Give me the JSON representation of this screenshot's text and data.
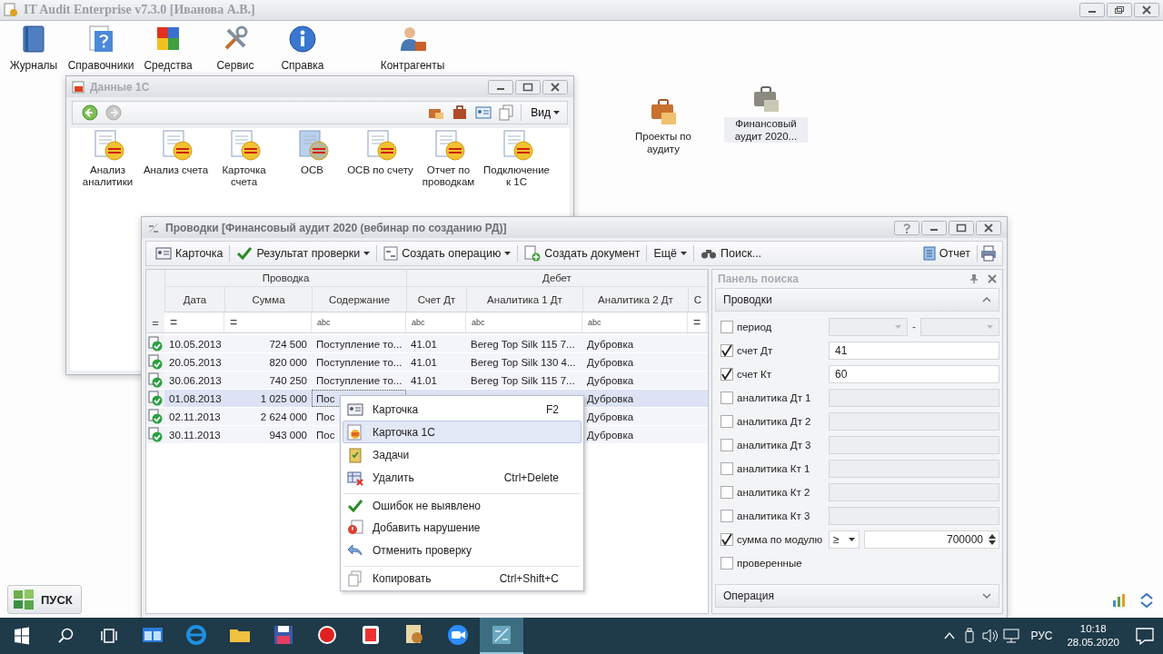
{
  "app": {
    "title": "IT Audit Enterprise v7.3.0 [Иванова А.В.]"
  },
  "ribbon": [
    {
      "label": "Журналы"
    },
    {
      "label": "Справочники"
    },
    {
      "label": "Средства"
    },
    {
      "label": "Сервис"
    },
    {
      "label": "Справка"
    },
    {
      "label": "Контрагенты"
    }
  ],
  "desktop_icons": [
    {
      "label": "Проекты по аудиту",
      "selected": false
    },
    {
      "label": "Финансовый аудит 2020...",
      "selected": true
    }
  ],
  "data_window": {
    "title": "Данные 1С",
    "view_menu": "Вид",
    "items": [
      {
        "label": "Анализ аналитики",
        "selected": false
      },
      {
        "label": "Анализ счета",
        "selected": false
      },
      {
        "label": "Карточка счета",
        "selected": false
      },
      {
        "label": "ОСВ",
        "selected": true
      },
      {
        "label": "ОСВ по счету",
        "selected": false
      },
      {
        "label": "Отчет по проводкам",
        "selected": false
      },
      {
        "label": "Подключение к 1С",
        "selected": false
      }
    ]
  },
  "entries_window": {
    "title": "Проводки [Финансовый аудит 2020 (вебинар по созданию РД)]",
    "toolbar": [
      {
        "label": "Карточка",
        "dropdown": false
      },
      {
        "label": "Результат проверки",
        "dropdown": true
      },
      {
        "label": "Создать операцию",
        "dropdown": true
      },
      {
        "label": "Создать документ",
        "dropdown": false
      },
      {
        "label": "Ещё",
        "dropdown": true
      },
      {
        "label": "Поиск...",
        "dropdown": false
      }
    ],
    "report_button": "Отчет",
    "table": {
      "bands": [
        {
          "label": "Проводка"
        },
        {
          "label": "Дебет"
        }
      ],
      "indicator_filter": "=",
      "columns": [
        {
          "label": "Дата",
          "filter": "="
        },
        {
          "label": "Сумма",
          "filter": "="
        },
        {
          "label": "Содержание",
          "filter": "abc"
        },
        {
          "label": "Счет Дт",
          "filter": "abc"
        },
        {
          "label": "Аналитика 1 Дт",
          "filter": "abc"
        },
        {
          "label": "Аналитика 2 Дт",
          "filter": "abc"
        },
        {
          "label": "С",
          "filter": "="
        }
      ],
      "rows": [
        {
          "checked": true,
          "selected": false,
          "cells": [
            "10.05.2013",
            "724 500",
            "Поступление то...",
            "41.01",
            "Bereg Top Silk 115 7...",
            "Дубровка"
          ]
        },
        {
          "checked": true,
          "selected": false,
          "cells": [
            "20.05.2013",
            "820 000",
            "Поступление то...",
            "41.01",
            "Bereg Top Silk 130 4...",
            "Дубровка"
          ]
        },
        {
          "checked": true,
          "selected": false,
          "cells": [
            "30.06.2013",
            "740 250",
            "Поступление то...",
            "41.01",
            "Bereg Top Silk 115 7...",
            "Дубровка"
          ]
        },
        {
          "checked": true,
          "selected": true,
          "cells": [
            "01.08.2013",
            "1 025 000",
            "Пос",
            null,
            null,
            "Дубровка"
          ]
        },
        {
          "checked": true,
          "selected": false,
          "cells": [
            "02.11.2013",
            "2 624 000",
            "Пос",
            null,
            null,
            "Дубровка"
          ]
        },
        {
          "checked": true,
          "selected": false,
          "cells": [
            "30.11.2013",
            "943 000",
            "Пос",
            null,
            null,
            "Дубровка"
          ]
        }
      ]
    },
    "context_menu": [
      {
        "label": "Карточка",
        "shortcut": "F2",
        "selected": false,
        "separator": false
      },
      {
        "label": "Карточка 1С",
        "selected": true,
        "separator": false
      },
      {
        "label": "Задачи",
        "selected": false,
        "separator": false
      },
      {
        "label": "Удалить",
        "shortcut": "Ctrl+Delete",
        "selected": false,
        "separator": false
      },
      {
        "label": "Ошибок не выявлено",
        "selected": false,
        "separator": true
      },
      {
        "label": "Добавить нарушение",
        "selected": false,
        "separator": false
      },
      {
        "label": "Отменить проверку",
        "selected": false,
        "separator": false
      },
      {
        "label": "Копировать",
        "shortcut": "Ctrl+Shift+C",
        "selected": false,
        "separator": true
      }
    ],
    "search_panel": {
      "title": "Панель поиска",
      "sections": [
        {
          "label": "Проводки",
          "expanded": true
        },
        {
          "label": "Операция",
          "expanded": false
        }
      ],
      "filters": [
        {
          "kind": "range",
          "label": "период",
          "checked": false,
          "separator": "-"
        },
        {
          "kind": "text",
          "label": "счет Дт",
          "checked": true,
          "value": "41"
        },
        {
          "kind": "text",
          "label": "счет Кт",
          "checked": true,
          "value": "60"
        },
        {
          "kind": "text",
          "label": "аналитика Дт 1",
          "checked": false
        },
        {
          "kind": "text",
          "label": "аналитика Дт 2",
          "checked": false
        },
        {
          "kind": "text",
          "label": "аналитика Дт 3",
          "checked": false
        },
        {
          "kind": "text",
          "label": "аналитика Кт 1",
          "checked": false
        },
        {
          "kind": "text",
          "label": "аналитика Кт 2",
          "checked": false
        },
        {
          "kind": "text",
          "label": "аналитика Кт 3",
          "checked": false
        },
        {
          "kind": "compare",
          "label": "сумма по модулю",
          "checked": true,
          "operator": "≥",
          "value": "700000"
        },
        {
          "kind": "flag",
          "label": "проверенные",
          "checked": false
        }
      ]
    }
  },
  "start_button": "ПУСК",
  "taskbar": {
    "apps": [
      {
        "selected": false
      },
      {
        "selected": false
      },
      {
        "selected": false
      },
      {
        "selected": false
      },
      {
        "selected": false
      },
      {
        "selected": false
      },
      {
        "selected": false
      },
      {
        "selected": false
      },
      {
        "selected": true
      }
    ],
    "language": "РУС",
    "time": "10:18",
    "date": "28.05.2020"
  }
}
